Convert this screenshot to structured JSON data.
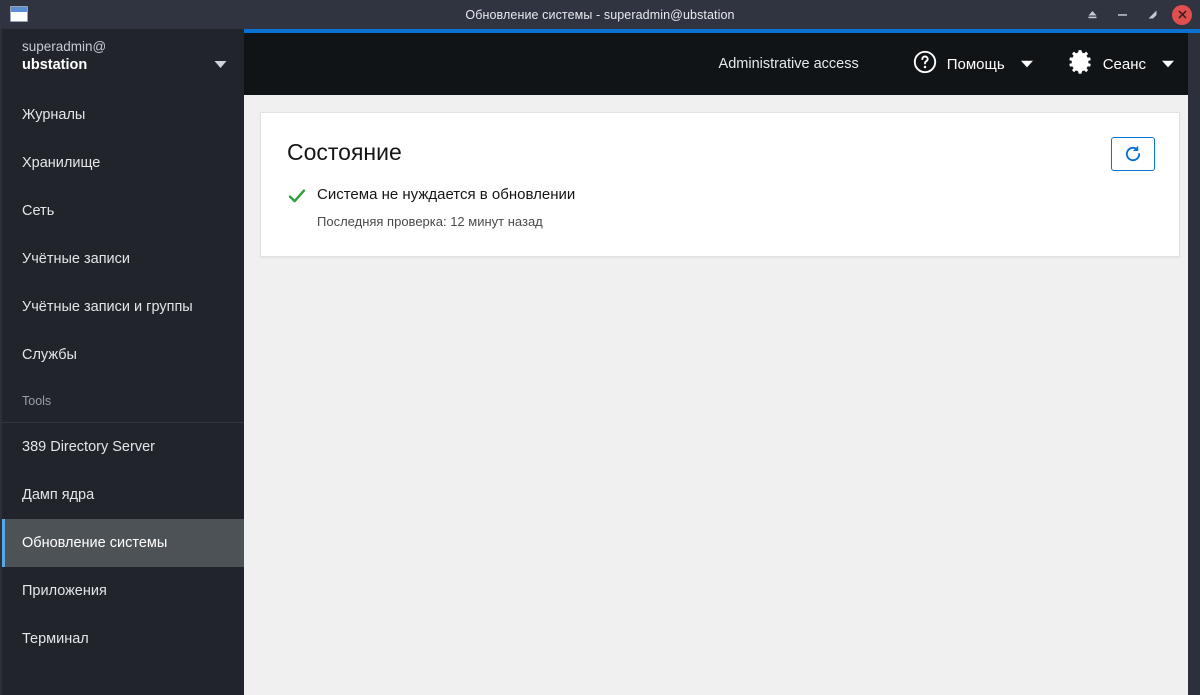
{
  "titlebar": {
    "title": "Обновление системы - superadmin@ubstation",
    "icon": "window-icon",
    "controls": [
      {
        "name": "shade-button",
        "icon": "eject-icon"
      },
      {
        "name": "minimize-button",
        "icon": "minimize-icon"
      },
      {
        "name": "maximize-button",
        "icon": "maximize-icon"
      },
      {
        "name": "close-button",
        "icon": "close-icon"
      }
    ]
  },
  "colors": {
    "accent_blue": "#0b72d4",
    "active_item_border": "#5aa7e8",
    "close_red": "#e04f4f",
    "success_green": "#2e9e3e",
    "sidebar_bg": "#21252b",
    "header_bg": "#111417",
    "content_bg": "#f0f0f0"
  },
  "sidebar": {
    "account": {
      "user": "superadmin@",
      "host": "ubstation",
      "caret": "chevron-down-icon"
    },
    "items": [
      {
        "label": "Журналы",
        "active": false
      },
      {
        "label": "Хранилище",
        "active": false
      },
      {
        "label": "Сеть",
        "active": false
      },
      {
        "label": "Учётные записи",
        "active": false
      },
      {
        "label": "Учётные записи и группы",
        "active": false
      },
      {
        "label": "Службы",
        "active": false
      }
    ],
    "tools_section_title": "Tools",
    "tools_items": [
      {
        "label": "389 Directory Server",
        "active": false
      },
      {
        "label": "Дамп ядра",
        "active": false
      },
      {
        "label": "Обновление системы",
        "active": true
      },
      {
        "label": "Приложения",
        "active": false
      },
      {
        "label": "Терминал",
        "active": false
      }
    ]
  },
  "header": {
    "admin_access": "Administrative access",
    "help_menu": {
      "label": "Помощь",
      "icon": "help-circle-icon",
      "caret": "caret-down-icon"
    },
    "session_menu": {
      "label": "Сеанс",
      "icon": "gear-icon",
      "caret": "caret-down-icon"
    }
  },
  "main": {
    "card": {
      "title": "Состояние",
      "status_icon": "check-icon",
      "status_text": "Система не нуждается в обновлении",
      "last_check": "Последняя проверка: 12 минут назад",
      "refresh_button_icon": "refresh-icon"
    }
  }
}
